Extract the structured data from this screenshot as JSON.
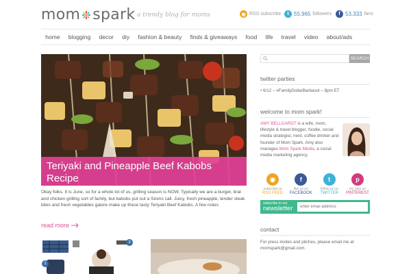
{
  "header": {
    "logo_left": "mom",
    "logo_right": "spark",
    "tagline": "a trendy blog for moms",
    "rss": {
      "label": "RSS subscribe",
      "color": "#f0a420"
    },
    "twitter": {
      "count": "55,965",
      "label": "followers",
      "color": "#3fb1d8"
    },
    "facebook": {
      "count": "53,333",
      "label": "fans",
      "color": "#3b5998"
    }
  },
  "nav": [
    "home",
    "blogging",
    "decor",
    "diy",
    "fashion & beauty",
    "finds & giveaways",
    "food",
    "life",
    "travel",
    "video",
    "about/ads"
  ],
  "hero": {
    "title": "Teriyaki and Pineapple Beef Kabobs Recipe",
    "accent": "#e24096"
  },
  "excerpt": "Okay folks. It is June, so for a whole lot of us, grilling season is NOW. Typically we are a burger, brat and chicken grilling sort of family, but kabobs put out a Sirens call. Juicy, fresh pineapple, tender steak bites and fresh vegetables galore make up these tasty Teriyaki Beef Kabobs. A few notes",
  "read_more": "read more",
  "thumbs": {
    "badge_a": "1",
    "badge_b": "3"
  },
  "sidebar": {
    "search_placeholder": "",
    "search_button": "SEARCH",
    "twitter_parties": {
      "heading": "twitter parties",
      "item": "6/12 – #FamilyDollarBarbasol – 8pm ET"
    },
    "welcome": {
      "heading": "welcome to mom spark!",
      "name": "AMY BELLGARDT",
      "bio": " is a wife, mom, lifestyle & travel blogger, foodie, social media strategist, nerd, coffee drinker and founder of Mom Spark. Amy also manages ",
      "link": "Mom Spark Media",
      "bio_end": ", a social media marketing agency."
    },
    "follow": [
      {
        "small": "subscribe to",
        "big": "RSS FEED",
        "icon": "rss-icon",
        "color": "#f0a420",
        "glyph": "◉"
      },
      {
        "small": "like us on",
        "big": "FACEBOOK",
        "icon": "facebook-icon",
        "color": "#3b5998",
        "glyph": "f"
      },
      {
        "small": "follow us on",
        "big": "TWITTER",
        "icon": "twitter-icon",
        "color": "#3fb1d8",
        "glyph": "t"
      },
      {
        "small": "my pins on",
        "big": "PINTEREST",
        "icon": "pinterest-icon",
        "color": "#d43a7e",
        "glyph": "p"
      }
    ],
    "newsletter": {
      "small": "subscribe to our",
      "big": "newsletter",
      "placeholder": "enter email address",
      "color": "#3fb98d"
    },
    "contact": {
      "heading": "contact",
      "text": "For press invites and pitches, please email me at",
      "email": "momspark@gmail.com."
    }
  }
}
